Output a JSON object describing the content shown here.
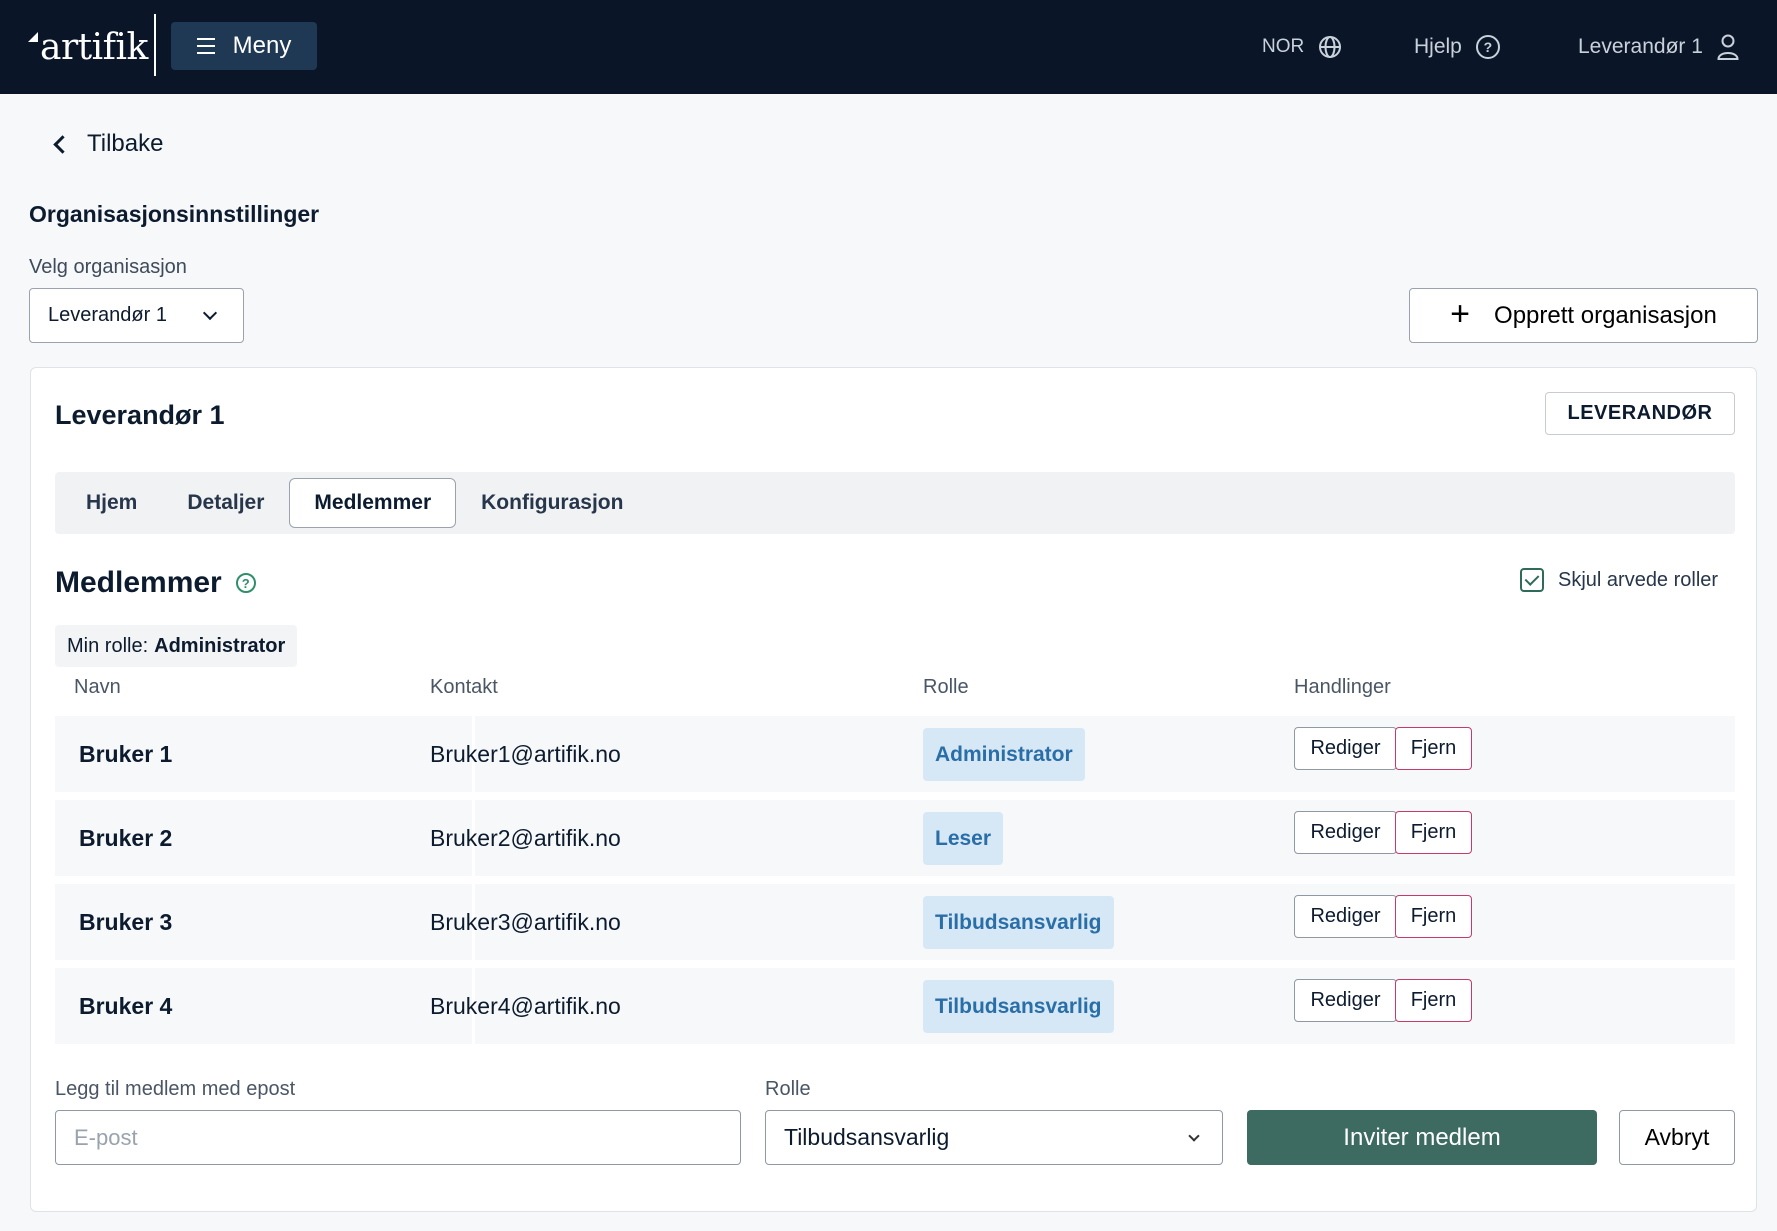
{
  "header": {
    "logo": "artifik",
    "menu_label": "Meny",
    "language": "NOR",
    "help_label": "Hjelp",
    "user_label": "Leverandør 1"
  },
  "nav": {
    "back_label": "Tilbake"
  },
  "page": {
    "title": "Organisasjonsinnstillinger",
    "select_org_label": "Velg organisasjon",
    "selected_org": "Leverandør 1",
    "create_org_label": "Opprett organisasjon"
  },
  "org": {
    "name": "Leverandør 1",
    "type_badge": "LEVERANDØR",
    "tabs": [
      {
        "label": "Hjem",
        "active": false
      },
      {
        "label": "Detaljer",
        "active": false
      },
      {
        "label": "Medlemmer",
        "active": true
      },
      {
        "label": "Konfigurasjon",
        "active": false
      }
    ]
  },
  "members": {
    "title": "Medlemmer",
    "hide_inherited_label": "Skjul arvede roller",
    "hide_inherited_checked": true,
    "my_role_label": "Min rolle:",
    "my_role_value": "Administrator",
    "columns": [
      "Navn",
      "Kontakt",
      "Rolle",
      "Handlinger"
    ],
    "rows": [
      {
        "name": "Bruker 1",
        "contact": "Bruker1@artifik.no",
        "role": "Administrator"
      },
      {
        "name": "Bruker 2",
        "contact": "Bruker2@artifik.no",
        "role": "Leser"
      },
      {
        "name": "Bruker 3",
        "contact": "Bruker3@artifik.no",
        "role": "Tilbudsansvarlig"
      },
      {
        "name": "Bruker 4",
        "contact": "Bruker4@artifik.no",
        "role": "Tilbudsansvarlig"
      }
    ],
    "edit_label": "Rediger",
    "remove_label": "Fjern"
  },
  "invite": {
    "email_label": "Legg til medlem med epost",
    "email_placeholder": "E-post",
    "email_value": "",
    "role_label": "Rolle",
    "role_value": "Tilbudsansvarlig",
    "invite_label": "Inviter medlem",
    "cancel_label": "Avbryt"
  },
  "colors": {
    "topbar": "#0a1628",
    "menu_button": "#1f3954",
    "primary_button": "#3d6b61",
    "role_pill_bg": "#d6e8f6",
    "role_pill_text": "#2a6ea8",
    "remove_border": "#c53a6b"
  }
}
